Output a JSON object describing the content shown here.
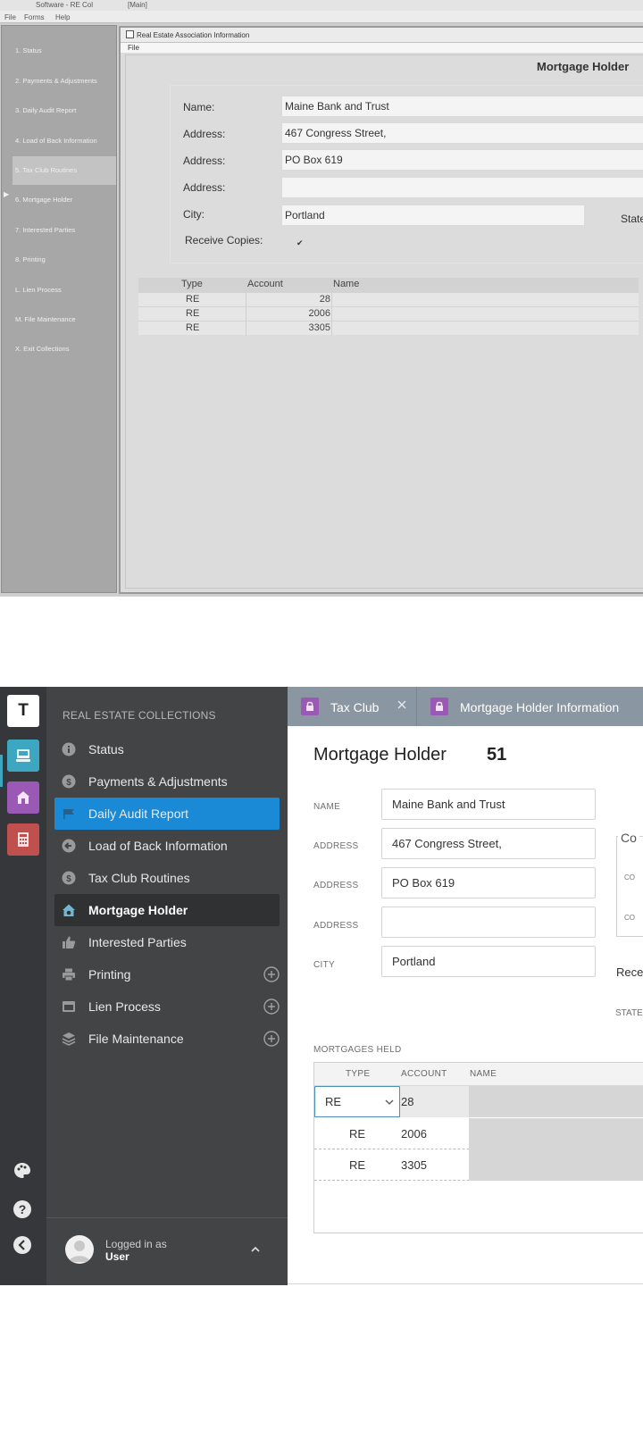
{
  "old_ui": {
    "titlebar": {
      "app": "Software - RE Col",
      "window": "[Main]"
    },
    "menubar": [
      "File",
      "Forms",
      "Help"
    ],
    "sidebar": [
      "1. Status",
      "2. Payments & Adjustments",
      "3. Daily Audit Report",
      "4. Load of Back Information",
      "5. Tax Club Routines",
      "6. Mortgage Holder",
      "7. Interested Parties",
      "8. Printing",
      "L. Lien Process",
      "M. File Maintenance",
      "X. Exit Collections"
    ],
    "window": {
      "title": "Real Estate Association Information",
      "menu": "File",
      "heading": "Mortgage Holder",
      "labels": {
        "name": "Name:",
        "address": "Address:",
        "city": "City:",
        "state": "State",
        "receive": "Receive Copies:"
      },
      "values": {
        "name": "Maine Bank and Trust",
        "address1": "467 Congress Street,",
        "address2": "PO Box 619",
        "address3": "",
        "city": "Portland",
        "receive_copies": "✔"
      },
      "grid": {
        "headers": [
          "Type",
          "Account",
          "Name"
        ],
        "rows": [
          {
            "type": "RE",
            "account": "28"
          },
          {
            "type": "RE",
            "account": "2006"
          },
          {
            "type": "RE",
            "account": "3305"
          }
        ]
      }
    }
  },
  "new_ui": {
    "rail": {
      "logo": "T"
    },
    "nav": {
      "title": "REAL ESTATE COLLECTIONS",
      "items": [
        "Status",
        "Payments & Adjustments",
        "Daily Audit Report",
        "Load of Back Information",
        "Tax Club Routines",
        "Mortgage Holder",
        "Interested Parties",
        "Printing",
        "Lien Process",
        "File Maintenance"
      ],
      "login_line1": "Logged in as",
      "login_line2": "User"
    },
    "tabs": [
      {
        "label": "Tax Club",
        "close": "×"
      },
      {
        "label": "Mortgage Holder Information"
      }
    ],
    "form": {
      "title": "Mortgage Holder",
      "number": "51",
      "labels": {
        "name": "NAME",
        "address": "ADDRESS",
        "city": "CITY",
        "state": "STATE",
        "receive": "Rece",
        "mortgages": "MORTGAGES HELD",
        "copies_legend": "Co",
        "co": "CO"
      },
      "values": {
        "name": "Maine Bank and Trust",
        "address1": "467 Congress Street,",
        "address2": "PO Box 619",
        "address3": "",
        "city": "Portland"
      }
    },
    "table": {
      "headers": [
        "TYPE",
        "ACCOUNT",
        "NAME"
      ],
      "rows": [
        {
          "type": "RE",
          "account": "28"
        },
        {
          "type": "RE",
          "account": "2006"
        },
        {
          "type": "RE",
          "account": "3305"
        }
      ]
    },
    "colors": {
      "active_nav": "#1b8ad6",
      "rail_teal": "#3da6c0",
      "rail_purple": "#9b59b6",
      "rail_red": "#c0504d",
      "tabbar": "#8a96a2"
    }
  }
}
